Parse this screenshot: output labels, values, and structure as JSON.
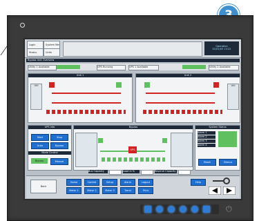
{
  "callout": {
    "number": "3"
  },
  "screen": {
    "tabs": [
      {
        "label": "Login"
      },
      {
        "label": "System Messages"
      },
      {
        "label": "Status"
      },
      {
        "label": "Units"
      }
    ],
    "banner": "Bypass Unit Overview",
    "status_right": [
      "Operation",
      "01/01/03 13:22"
    ],
    "status_chips": [
      "Utility 1 Available",
      "UPS Running",
      "UPS 1 Available",
      "Utility 2 Available"
    ],
    "unit_titles": [
      "Unit 1",
      "Unit 2"
    ],
    "unit_labels": {
      "left": "Util",
      "right": "Util"
    },
    "ups_info_title": "UPS Info",
    "ups_buttons": [
      "Start",
      "Stop",
      "Auto",
      "Bypass"
    ],
    "ups_subtitle": "Mode Control",
    "ups_mode": [
      "Bypass",
      "Manual"
    ],
    "center_title": "Bypass",
    "center_block": "UPS",
    "system_title": "System Status",
    "system_items": [
      "Alarm 1",
      "Alarm 2",
      "Alarm 3",
      "Alarm 4"
    ],
    "system_buttons": [
      "Reset",
      "Silence"
    ],
    "footer_labels": [
      "Bus Capacity",
      "Load in %",
      "Reserve Capacity"
    ],
    "bottom_left": "Back",
    "bottom_row1": [
      "Home",
      "Control",
      "Setup",
      "Alarm",
      "Logout"
    ],
    "bottom_row2": [
      "Meter 1",
      "Meter 2",
      "Meter 3",
      "Trend",
      "Print"
    ],
    "bottom_right": "Help"
  }
}
